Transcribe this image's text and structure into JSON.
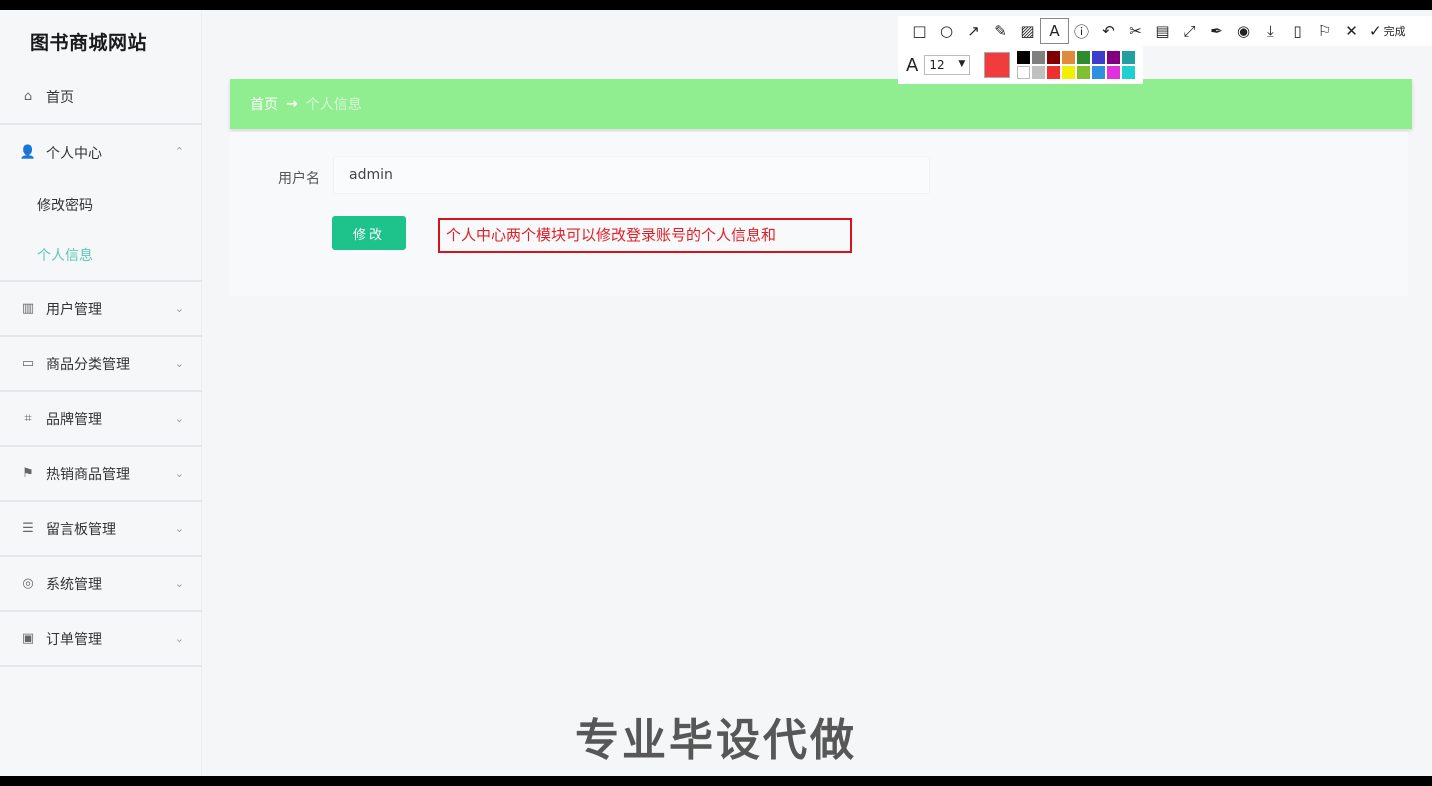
{
  "brand": {
    "title": "图书商城网站"
  },
  "sidebar": {
    "items": [
      {
        "label": "首页",
        "icon": "home-icon",
        "glyph": "⌂"
      },
      {
        "label": "个人中心",
        "icon": "user-icon",
        "glyph": "👤",
        "chevron": "⌃",
        "children": [
          {
            "label": "修改密码"
          },
          {
            "label": "个人信息"
          }
        ]
      },
      {
        "label": "用户管理",
        "icon": "chart-icon",
        "glyph": "▥",
        "chevron": "⌄"
      },
      {
        "label": "商品分类管理",
        "icon": "briefcase-icon",
        "glyph": "▭",
        "chevron": "⌄"
      },
      {
        "label": "品牌管理",
        "icon": "crop-icon",
        "glyph": "⌗",
        "chevron": "⌄"
      },
      {
        "label": "热销商品管理",
        "icon": "flag-icon",
        "glyph": "⚑",
        "chevron": "⌄"
      },
      {
        "label": "留言板管理",
        "icon": "list-icon",
        "glyph": "☰",
        "chevron": "⌄"
      },
      {
        "label": "系统管理",
        "icon": "globe-icon",
        "glyph": "◎",
        "chevron": "⌄"
      },
      {
        "label": "订单管理",
        "icon": "order-icon",
        "glyph": "▣",
        "chevron": "⌄"
      }
    ]
  },
  "breadcrumb": {
    "home": "首页",
    "sep": "→",
    "current": "个人信息"
  },
  "form": {
    "username_label": "用户名",
    "username_value": "admin",
    "submit_label": "修改"
  },
  "annotation": {
    "text": "个人中心两个模块可以修改登录账号的个人信息和"
  },
  "toolbar": {
    "icons": [
      {
        "name": "rectangle-tool-icon",
        "glyph": "□"
      },
      {
        "name": "ellipse-tool-icon",
        "glyph": "○"
      },
      {
        "name": "arrow-tool-icon",
        "glyph": "↗"
      },
      {
        "name": "pen-tool-icon",
        "glyph": "✎"
      },
      {
        "name": "mosaic-tool-icon",
        "glyph": "▨"
      },
      {
        "name": "text-tool-icon",
        "glyph": "A",
        "selected": true
      },
      {
        "name": "number-tool-icon",
        "glyph": "ⓘ"
      },
      {
        "name": "undo-icon",
        "glyph": "↶"
      },
      {
        "name": "cut-icon",
        "glyph": "✂"
      },
      {
        "name": "ocr-icon",
        "glyph": "▤"
      },
      {
        "name": "fit-icon",
        "glyph": "⤢"
      },
      {
        "name": "pin-icon",
        "glyph": "✒"
      },
      {
        "name": "record-icon",
        "glyph": "◉"
      },
      {
        "name": "download-icon",
        "glyph": "⤓"
      },
      {
        "name": "copy-icon",
        "glyph": "▯"
      },
      {
        "name": "bookmark-icon",
        "glyph": "⚐"
      },
      {
        "name": "close-icon",
        "glyph": "✕"
      }
    ],
    "done_label": "完成",
    "font_glyph": "A",
    "font_size": "12",
    "current_color": "#f03c3c",
    "palette": [
      "#000000",
      "#808080",
      "#800000",
      "#e08a3c",
      "#2e8b2e",
      "#3c3ccf",
      "#800080",
      "#20a0a0",
      "#ffffff",
      "#c0c0c0",
      "#ee3030",
      "#f0f000",
      "#80c030",
      "#3090e0",
      "#e030e0",
      "#20d0d0"
    ]
  },
  "watermark": {
    "text": "专业毕设代做"
  }
}
